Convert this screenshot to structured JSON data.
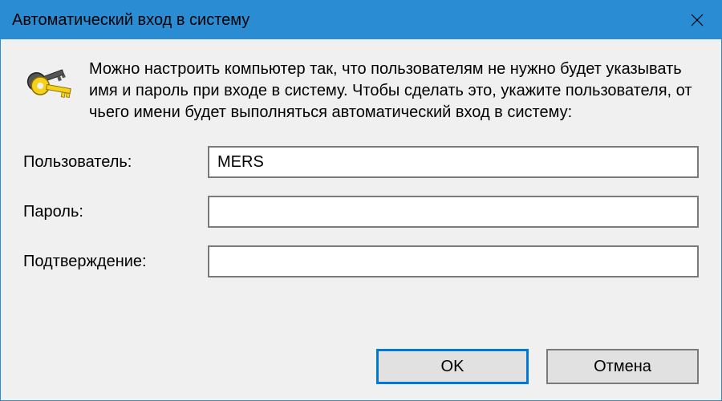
{
  "titlebar": {
    "title": "Автоматический вход в систему"
  },
  "description": "Можно настроить компьютер так, что пользователям не нужно будет указывать имя и пароль при входе в систему. Чтобы сделать это, укажите пользователя, от чьего имени будет выполняться автоматический вход в систему:",
  "form": {
    "user_label": "Пользователь:",
    "user_value": "MERS",
    "password_label": "Пароль:",
    "password_value": "",
    "confirm_label": "Подтверждение:",
    "confirm_value": ""
  },
  "buttons": {
    "ok": "OK",
    "cancel": "Отмена"
  }
}
